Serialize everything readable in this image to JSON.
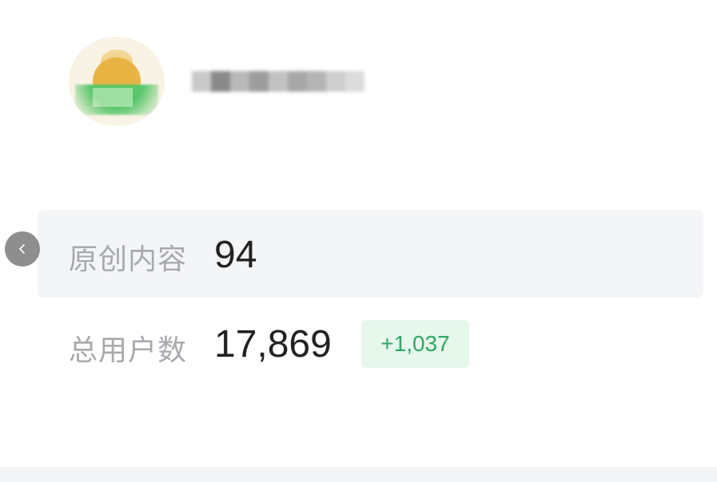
{
  "profile": {
    "avatar_icon": "avatar-icon",
    "username_blurred": true
  },
  "stats": {
    "original_content": {
      "label": "原创内容",
      "value": "94"
    },
    "total_users": {
      "label": "总用户数",
      "value": "17,869",
      "delta": "+1,037"
    }
  },
  "nav": {
    "back_icon": "chevron-left-icon"
  },
  "colors": {
    "card_bg": "#f4f5f7",
    "label": "#a7a9ad",
    "value": "#222222",
    "delta_text": "#2eaa63",
    "delta_bg": "#e6f7ec",
    "back_button": "#8e8e8e"
  }
}
